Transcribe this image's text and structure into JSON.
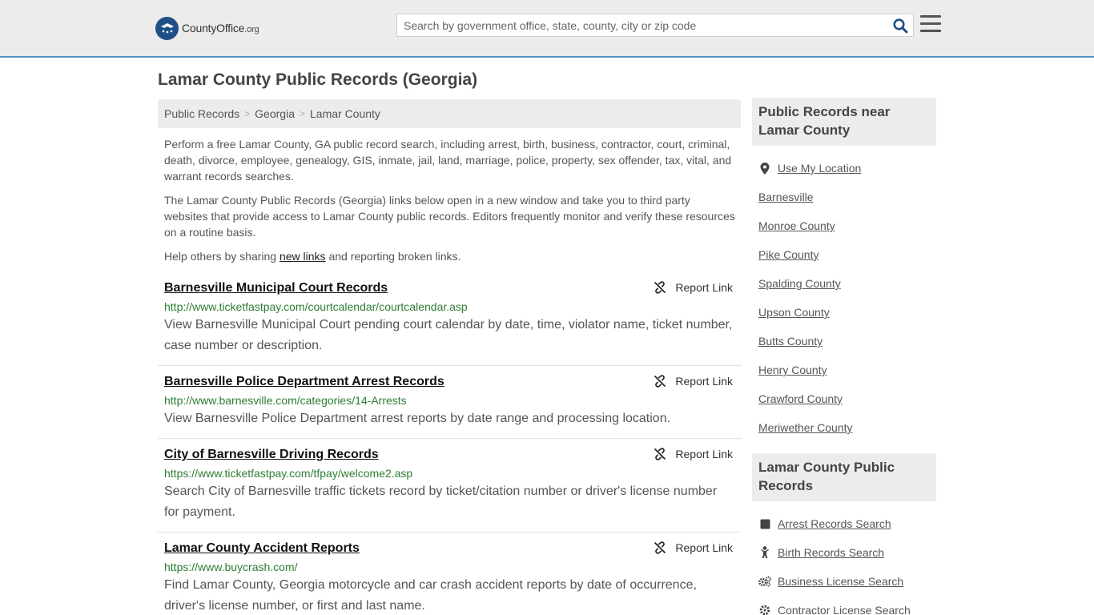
{
  "header": {
    "logo_main": "CountyOffice",
    "logo_suffix": ".org",
    "search_placeholder": "Search by government office, state, county, city or zip code",
    "search_icon": "search-icon",
    "menu_icon": "hamburger-menu-icon"
  },
  "page": {
    "title": "Lamar County Public Records (Georgia)"
  },
  "breadcrumb": [
    "Public Records",
    "Georgia",
    "Lamar County"
  ],
  "intro": {
    "p1": "Perform a free Lamar County, GA public record search, including arrest, birth, business, contractor, court, criminal, death, divorce, employee, genealogy, GIS, inmate, jail, land, marriage, police, property, sex offender, tax, vital, and warrant records searches.",
    "p2": "The Lamar County Public Records (Georgia) links below open in a new window and take you to third party websites that provide access to Lamar County public records. Editors frequently monitor and verify these resources on a routine basis.",
    "p3_before": "Help others by sharing ",
    "p3_link": "new links",
    "p3_after": " and reporting broken links."
  },
  "report_label": "Report Link",
  "records": [
    {
      "title": "Barnesville Municipal Court Records",
      "url": "http://www.ticketfastpay.com/courtcalendar/courtcalendar.asp",
      "desc": "View Barnesville Municipal Court pending court calendar by date, time, violator name, ticket number, case number or description."
    },
    {
      "title": "Barnesville Police Department Arrest Records",
      "url": "http://www.barnesville.com/categories/14-Arrests",
      "desc": "View Barnesville Police Department arrest reports by date range and processing location."
    },
    {
      "title": "City of Barnesville Driving Records",
      "url": "https://www.ticketfastpay.com/tfpay/welcome2.asp",
      "desc": "Search City of Barnesville traffic tickets record by ticket/citation number or driver's license number for payment."
    },
    {
      "title": "Lamar County Accident Reports",
      "url": "https://www.buycrash.com/",
      "desc": "Find Lamar County, Georgia motorcycle and car crash accident reports by date of occurrence, driver's license number, or first and last name."
    }
  ],
  "sidebar": {
    "nearby_heading": "Public Records near Lamar County",
    "use_location": "Use My Location",
    "nearby": [
      "Barnesville",
      "Monroe County",
      "Pike County",
      "Spalding County",
      "Upson County",
      "Butts County",
      "Henry County",
      "Crawford County",
      "Meriwether County"
    ],
    "records_heading": "Lamar County Public Records",
    "record_links": [
      {
        "label": "Arrest Records Search",
        "icon": "square-icon"
      },
      {
        "label": "Birth Records Search",
        "icon": "baby-icon"
      },
      {
        "label": "Business License Search",
        "icon": "gears-icon"
      },
      {
        "label": "Contractor License Search",
        "icon": "gear-icon"
      }
    ]
  },
  "colors": {
    "header_bg": "#ececec",
    "header_border": "#5b8fc7",
    "logo_blue": "#1e4f87",
    "url_green": "#2e7d32",
    "search_icon_blue": "#1e4f87"
  }
}
